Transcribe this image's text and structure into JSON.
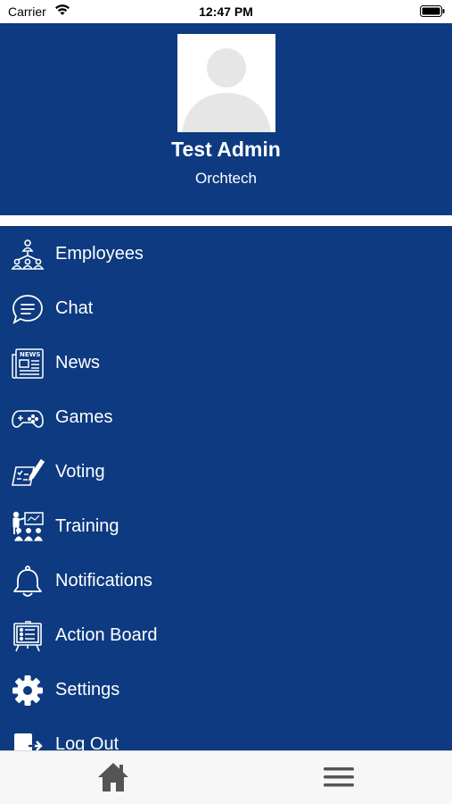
{
  "status_bar": {
    "carrier": "Carrier",
    "time": "12:47 PM"
  },
  "profile": {
    "name": "Test Admin",
    "organization": "Orchtech"
  },
  "menu": {
    "items": [
      {
        "label": "Employees",
        "icon": "employees-icon"
      },
      {
        "label": "Chat",
        "icon": "chat-icon"
      },
      {
        "label": "News",
        "icon": "news-icon"
      },
      {
        "label": "Games",
        "icon": "gamepad-icon"
      },
      {
        "label": "Voting",
        "icon": "voting-icon"
      },
      {
        "label": "Training",
        "icon": "training-icon"
      },
      {
        "label": "Notifications",
        "icon": "bell-icon"
      },
      {
        "label": "Action Board",
        "icon": "action-board-icon"
      },
      {
        "label": "Settings",
        "icon": "gear-icon"
      },
      {
        "label": "Log Out",
        "icon": "logout-icon"
      }
    ]
  },
  "tab_bar": {
    "icons": [
      "home-icon",
      "hamburger-menu-icon"
    ]
  },
  "colors": {
    "primary": "#0d3a80",
    "text_on_primary": "#ffffff",
    "tab_icon": "#555555"
  }
}
